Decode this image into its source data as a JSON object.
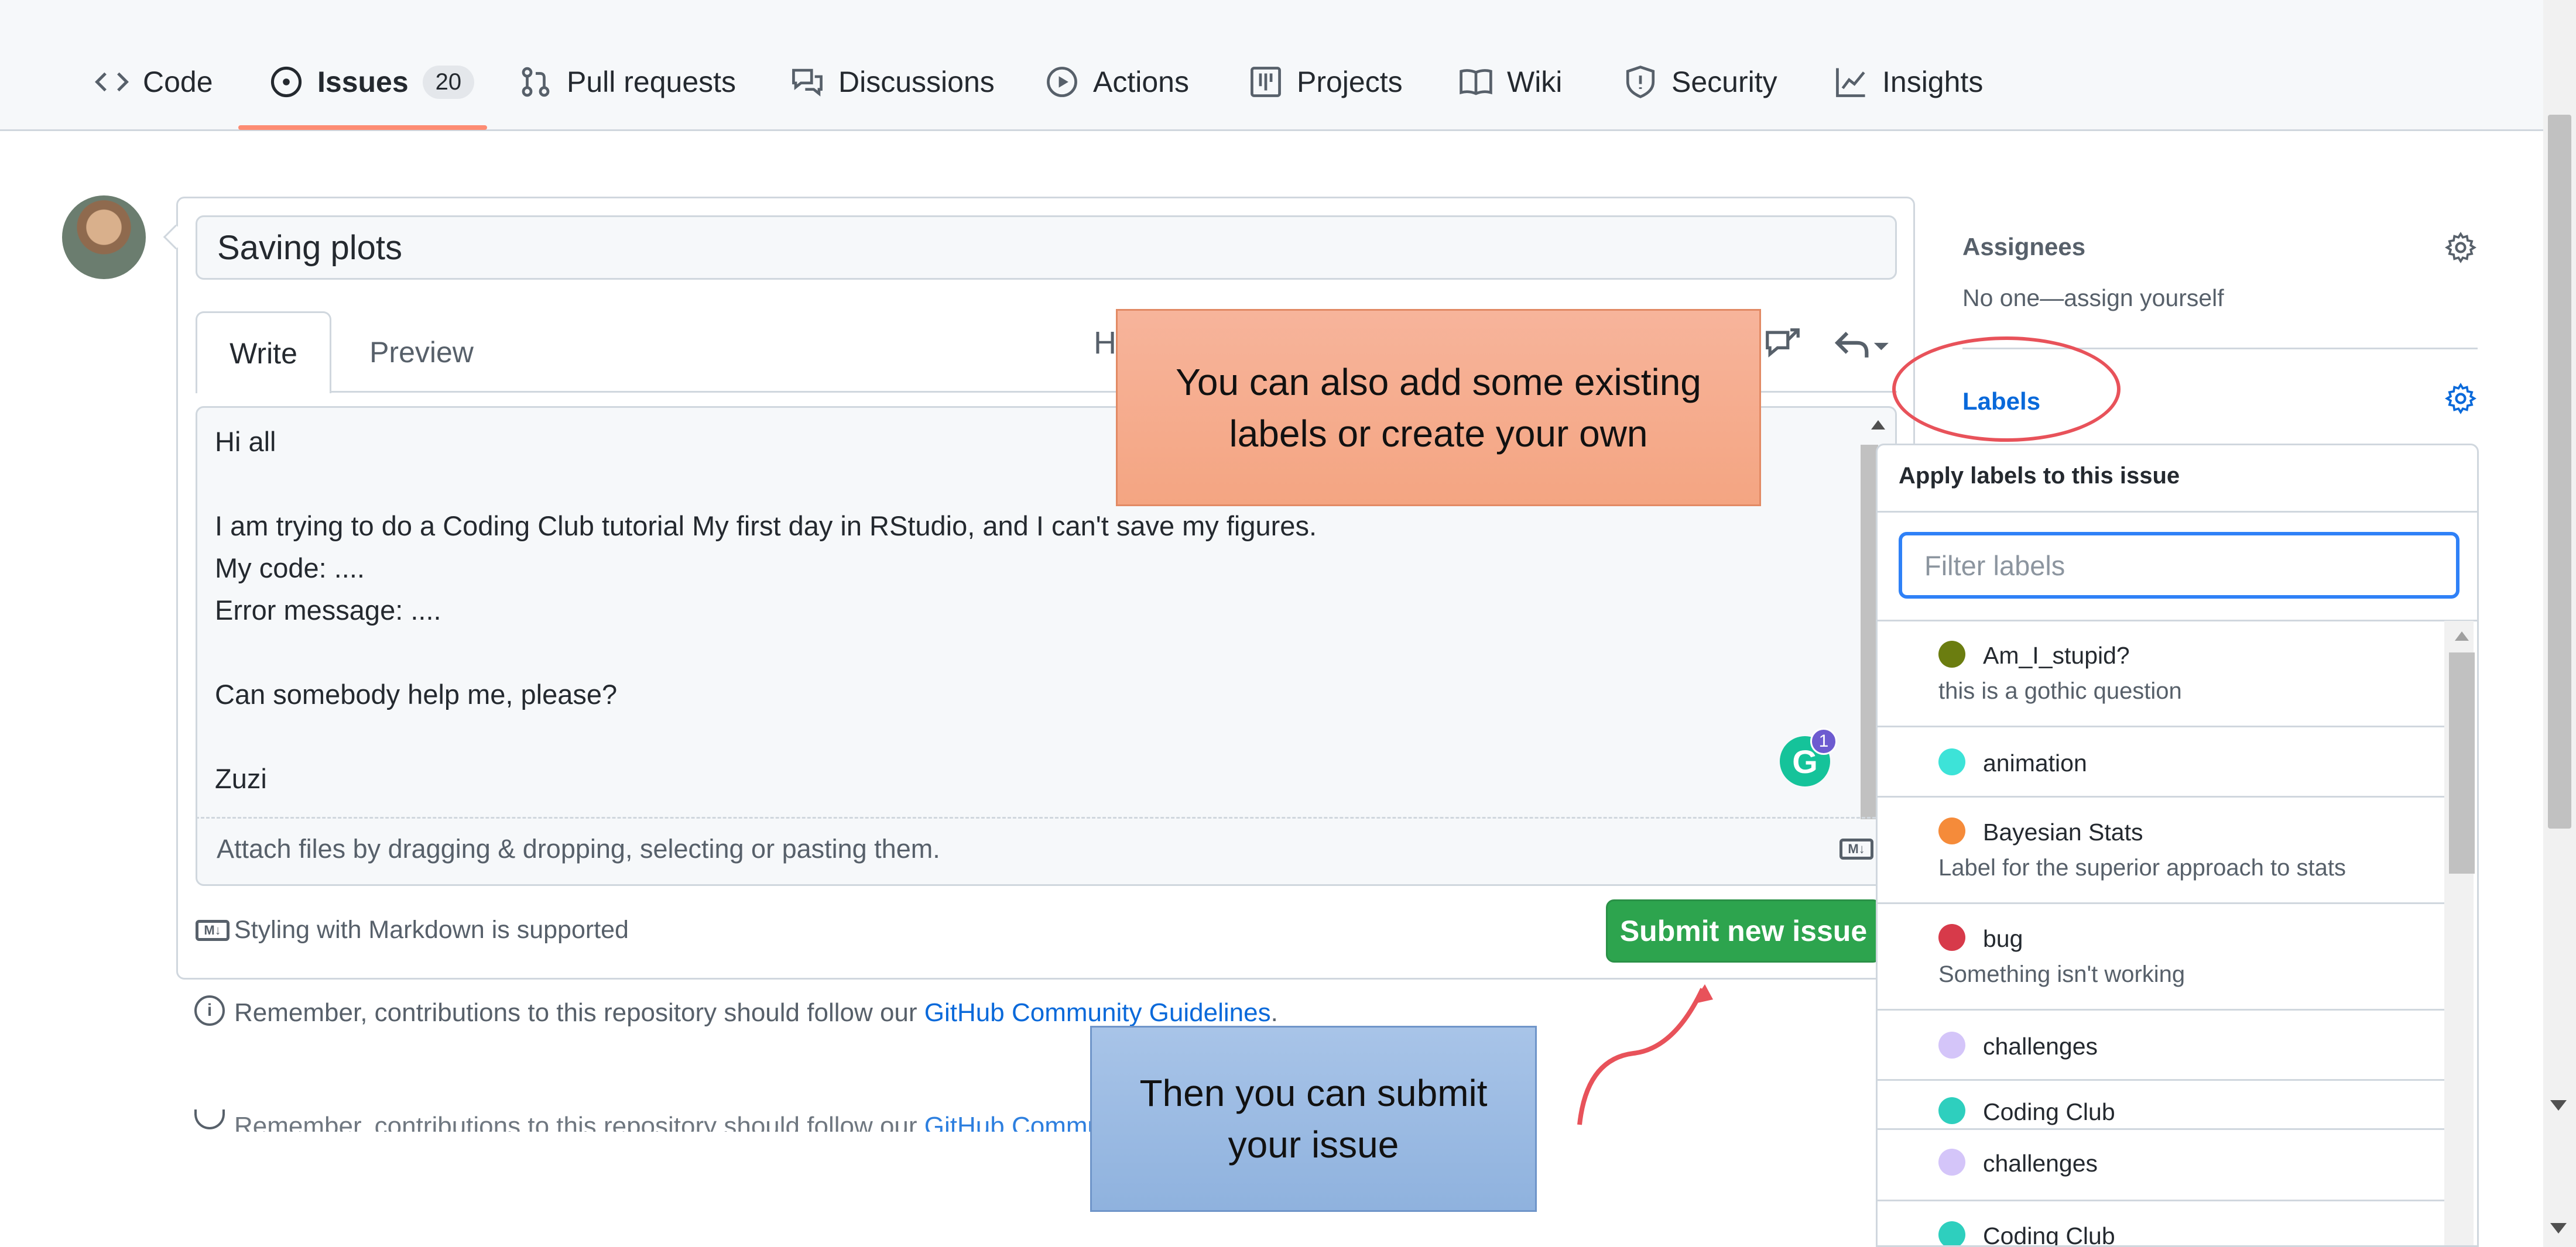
{
  "nav": {
    "items": [
      {
        "label": "Code",
        "icon": "code-icon"
      },
      {
        "label": "Issues",
        "icon": "issue-opened-icon",
        "count": "20"
      },
      {
        "label": "Pull requests",
        "icon": "git-pull-request-icon"
      },
      {
        "label": "Discussions",
        "icon": "comment-discussion-icon"
      },
      {
        "label": "Actions",
        "icon": "play-icon"
      },
      {
        "label": "Projects",
        "icon": "table-icon"
      },
      {
        "label": "Wiki",
        "icon": "book-icon"
      },
      {
        "label": "Security",
        "icon": "shield-icon"
      },
      {
        "label": "Insights",
        "icon": "graph-icon"
      }
    ],
    "active": "Issues"
  },
  "issue": {
    "title_value": "Saving plots",
    "tabs": {
      "write": "Write",
      "preview": "Preview"
    },
    "toolbar_heading": "H",
    "body_lines": [
      "Hi all",
      "",
      "I am trying to do a Coding Club tutorial My first day in RStudio, and I can't save my figures.",
      "My code: ....",
      "Error message: ....",
      "",
      "Can somebody help me, please?",
      "",
      "Zuzi"
    ],
    "attach_hint": "Attach files by dragging & dropping, selecting or pasting them.",
    "markdown_note": "Styling with Markdown is supported",
    "submit_label": "Submit new issue",
    "grammarly_badge": "1",
    "grammarly_letter": "G"
  },
  "footer": {
    "remember_prefix": "Remember, contributions to this repository should follow our ",
    "remember_link": "GitHub Community Guidelines",
    "remember_suffix": ".",
    "ghost_prefix": "Remember, contributions to this repository should follow our ",
    "ghost_link": "GitHub Community"
  },
  "sidebar": {
    "assignees_heading": "Assignees",
    "assignees_value": "No one—assign yourself",
    "labels_heading": "Labels"
  },
  "labels_dropdown": {
    "title": "Apply labels to this issue",
    "filter_placeholder": "Filter labels",
    "items": [
      {
        "name": "Am_I_stupid?",
        "description": "this is a gothic question",
        "color": "#6b7d10"
      },
      {
        "name": "animation",
        "description": "",
        "color": "#3de3d8"
      },
      {
        "name": "Bayesian Stats",
        "description": "Label for the superior approach to stats",
        "color": "#f58b3a"
      },
      {
        "name": "bug",
        "description": "Something isn't working",
        "color": "#d73a4a"
      },
      {
        "name": "challenges",
        "description": "",
        "color": "#d4c5f9"
      },
      {
        "name": "Coding Club",
        "description": "",
        "color": "#2ecfbe"
      },
      {
        "name": "challenges",
        "description": "",
        "color": "#d4c5f9"
      },
      {
        "name": "Coding Club",
        "description": "",
        "color": "#2ecfbe"
      }
    ]
  },
  "annotations": {
    "labels_callout": "You can also add some existing labels or create your own",
    "submit_callout": "Then you can submit your issue"
  },
  "colors": {
    "submit_green": "#2da44e",
    "link_blue": "#0969da",
    "active_underline": "#fd8c73",
    "callout_orange": "#f4a582",
    "callout_blue": "#8fb2de",
    "circle_red": "#e8525a"
  }
}
